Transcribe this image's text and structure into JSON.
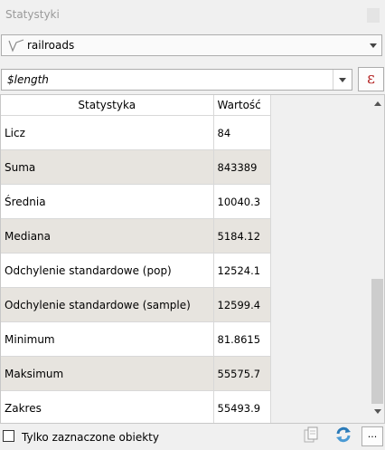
{
  "panel": {
    "title": "Statystyki"
  },
  "layer_select": {
    "value": "railroads",
    "icon": "line-layer-icon"
  },
  "field_select": {
    "value": "$length",
    "expression_button": "ε"
  },
  "table": {
    "headers": [
      "Statystyka",
      "Wartość"
    ],
    "rows": [
      [
        "Licz",
        "84"
      ],
      [
        "Suma",
        "843389"
      ],
      [
        "Średnia",
        "10040.3"
      ],
      [
        "Mediana",
        "5184.12"
      ],
      [
        "Odchylenie standardowe (pop)",
        "12524.1"
      ],
      [
        "Odchylenie standardowe (sample)",
        "12599.4"
      ],
      [
        "Minimum",
        "81.8615"
      ],
      [
        "Maksimum",
        "55575.7"
      ],
      [
        "Zakres",
        "55493.9"
      ]
    ]
  },
  "footer": {
    "selected_only_label": "Tylko zaznaczone obiekty",
    "selected_only_checked": false,
    "more_button": "..."
  },
  "colors": {
    "row_alt": "#e7e4df",
    "expression_accent": "#b52626",
    "refresh_accent": "#2a7ab8"
  }
}
